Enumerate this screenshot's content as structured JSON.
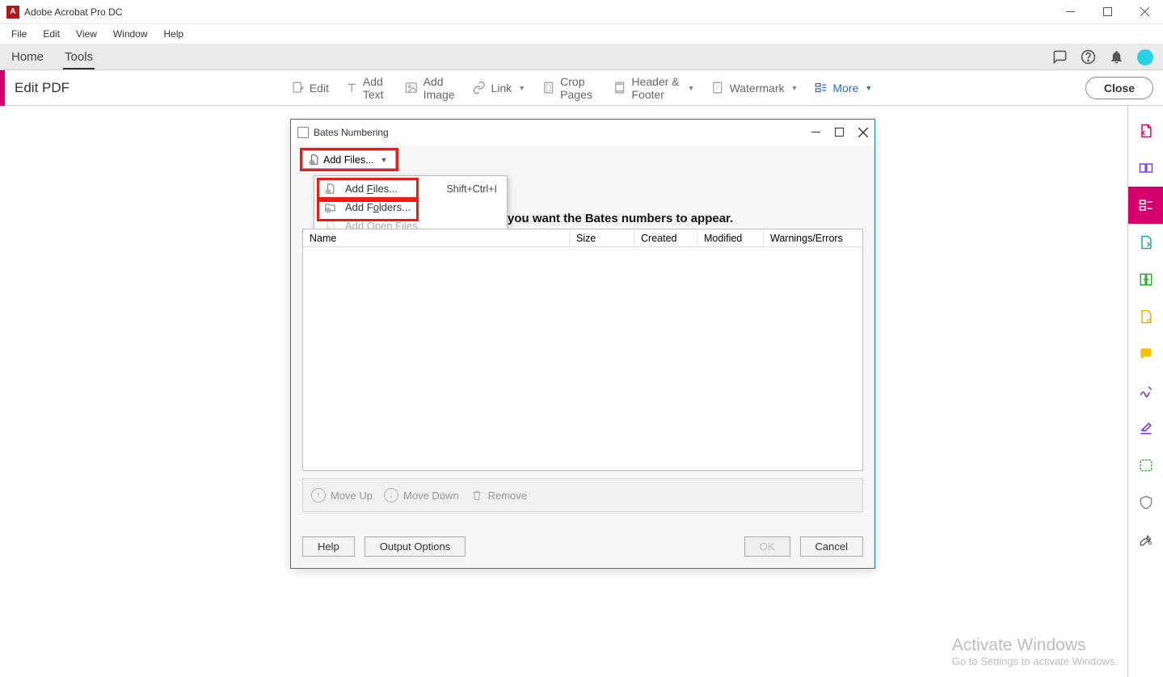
{
  "app": {
    "title": "Adobe Acrobat Pro DC"
  },
  "menubar": {
    "items": [
      "File",
      "Edit",
      "View",
      "Window",
      "Help"
    ]
  },
  "tabs": {
    "home": "Home",
    "tools": "Tools"
  },
  "toolbar": {
    "title": "Edit PDF",
    "edit": "Edit",
    "add_text": "Add Text",
    "add_image": "Add Image",
    "link": "Link",
    "crop": "Crop Pages",
    "header_footer": "Header & Footer",
    "watermark": "Watermark",
    "more": "More",
    "close": "Close"
  },
  "dialog": {
    "title": "Bates Numbering",
    "add_files_btn": "Add Files...",
    "instruction": "you want the Bates numbers to appear.",
    "columns": {
      "name": "Name",
      "size": "Size",
      "created": "Created",
      "modified": "Modified",
      "warnings": "Warnings/Errors"
    },
    "move_up": "Move Up",
    "move_down": "Move Down",
    "remove": "Remove",
    "help": "Help",
    "output_options": "Output Options",
    "ok": "OK",
    "cancel": "Cancel"
  },
  "context_menu": {
    "add_files": "Add Files...",
    "add_files_shortcut": "Shift+Ctrl+I",
    "add_folders": "Add Folders...",
    "add_open_files": "Add Open Files..."
  },
  "watermark": {
    "line1": "Activate Windows",
    "line2": "Go to Settings to activate Windows."
  }
}
